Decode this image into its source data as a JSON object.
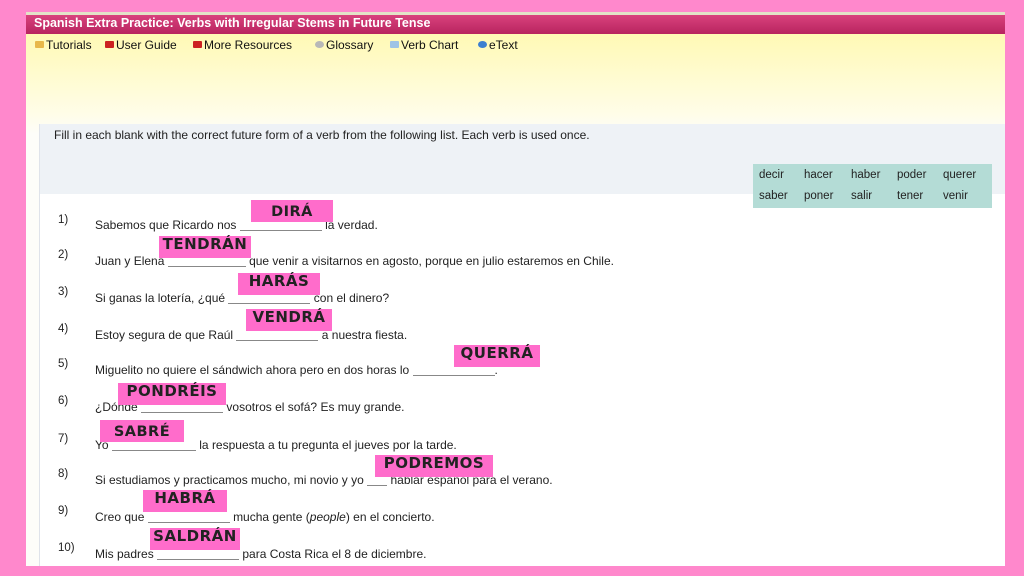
{
  "title": "Spanish Extra Practice: Verbs with Irregular Stems in Future Tense",
  "nav": [
    {
      "label": "Tutorials",
      "icon": "folder-icon",
      "color": "#e8b84a"
    },
    {
      "label": "User Guide",
      "icon": "briefcase-icon",
      "color": "#cc2222"
    },
    {
      "label": "More Resources",
      "icon": "briefcase-icon",
      "color": "#cc2222"
    },
    {
      "label": "Glossary",
      "icon": "book-icon",
      "color": "#b8b8b8"
    },
    {
      "label": "Verb Chart",
      "icon": "chart-icon",
      "color": "#9ec3e6"
    },
    {
      "label": "eText",
      "icon": "globe-icon",
      "color": "#3c7fd0"
    }
  ],
  "instructions": "Fill in each blank with the correct future form of a verb from the following list. Each verb is used once.",
  "verbs": [
    "decir",
    "hacer",
    "haber",
    "poder",
    "querer",
    "saber",
    "poner",
    "salir",
    "tener",
    "venir"
  ],
  "items": [
    {
      "num": "1)",
      "before": "Sabemos que Ricardo nos",
      "after": "la verdad.",
      "answer": "DIRÁ"
    },
    {
      "num": "2)",
      "before": "Juan y Elena",
      "after": "que venir a visitarnos en agosto, porque en julio estaremos en Chile.",
      "answer": "TENDRÁN"
    },
    {
      "num": "3)",
      "before": "Si ganas la lotería, ¿qué",
      "after": "con el dinero?",
      "answer": "HARÁS"
    },
    {
      "num": "4)",
      "before": "Estoy segura de que Raúl",
      "after": "a nuestra fiesta.",
      "answer": "VENDRÁ"
    },
    {
      "num": "5)",
      "before": "Miguelito no quiere el sándwich ahora pero en dos horas lo",
      "after": ".",
      "answer": "QUERRÁ"
    },
    {
      "num": "6)",
      "before": "¿Dónde",
      "after": "vosotros el sofá? Es muy grande.",
      "answer": "PONDRÉIS"
    },
    {
      "num": "7)",
      "before": "Yo",
      "after": "la respuesta a tu pregunta el jueves por la tarde.",
      "answer": "SABRÉ"
    },
    {
      "num": "8)",
      "before": "Si estudiamos y practicamos mucho, mi novio y yo",
      "after": "hablar español para el verano.",
      "answer": "PODREMOS"
    },
    {
      "num": "9)",
      "before": "Creo que",
      "after_pre": "mucha gente (",
      "after_em": "people",
      "after_post": ") en el concierto.",
      "answer": "HABRÁ"
    },
    {
      "num": "10)",
      "before": "Mis padres",
      "after": "para Costa Rica el 8 de diciembre.",
      "answer": "SALDRÁN"
    }
  ],
  "colors": {
    "accent": "#c2306b",
    "highlight": "#ff6ccb",
    "background": "#ff88cc",
    "verb_box": "#b4dcd6"
  }
}
